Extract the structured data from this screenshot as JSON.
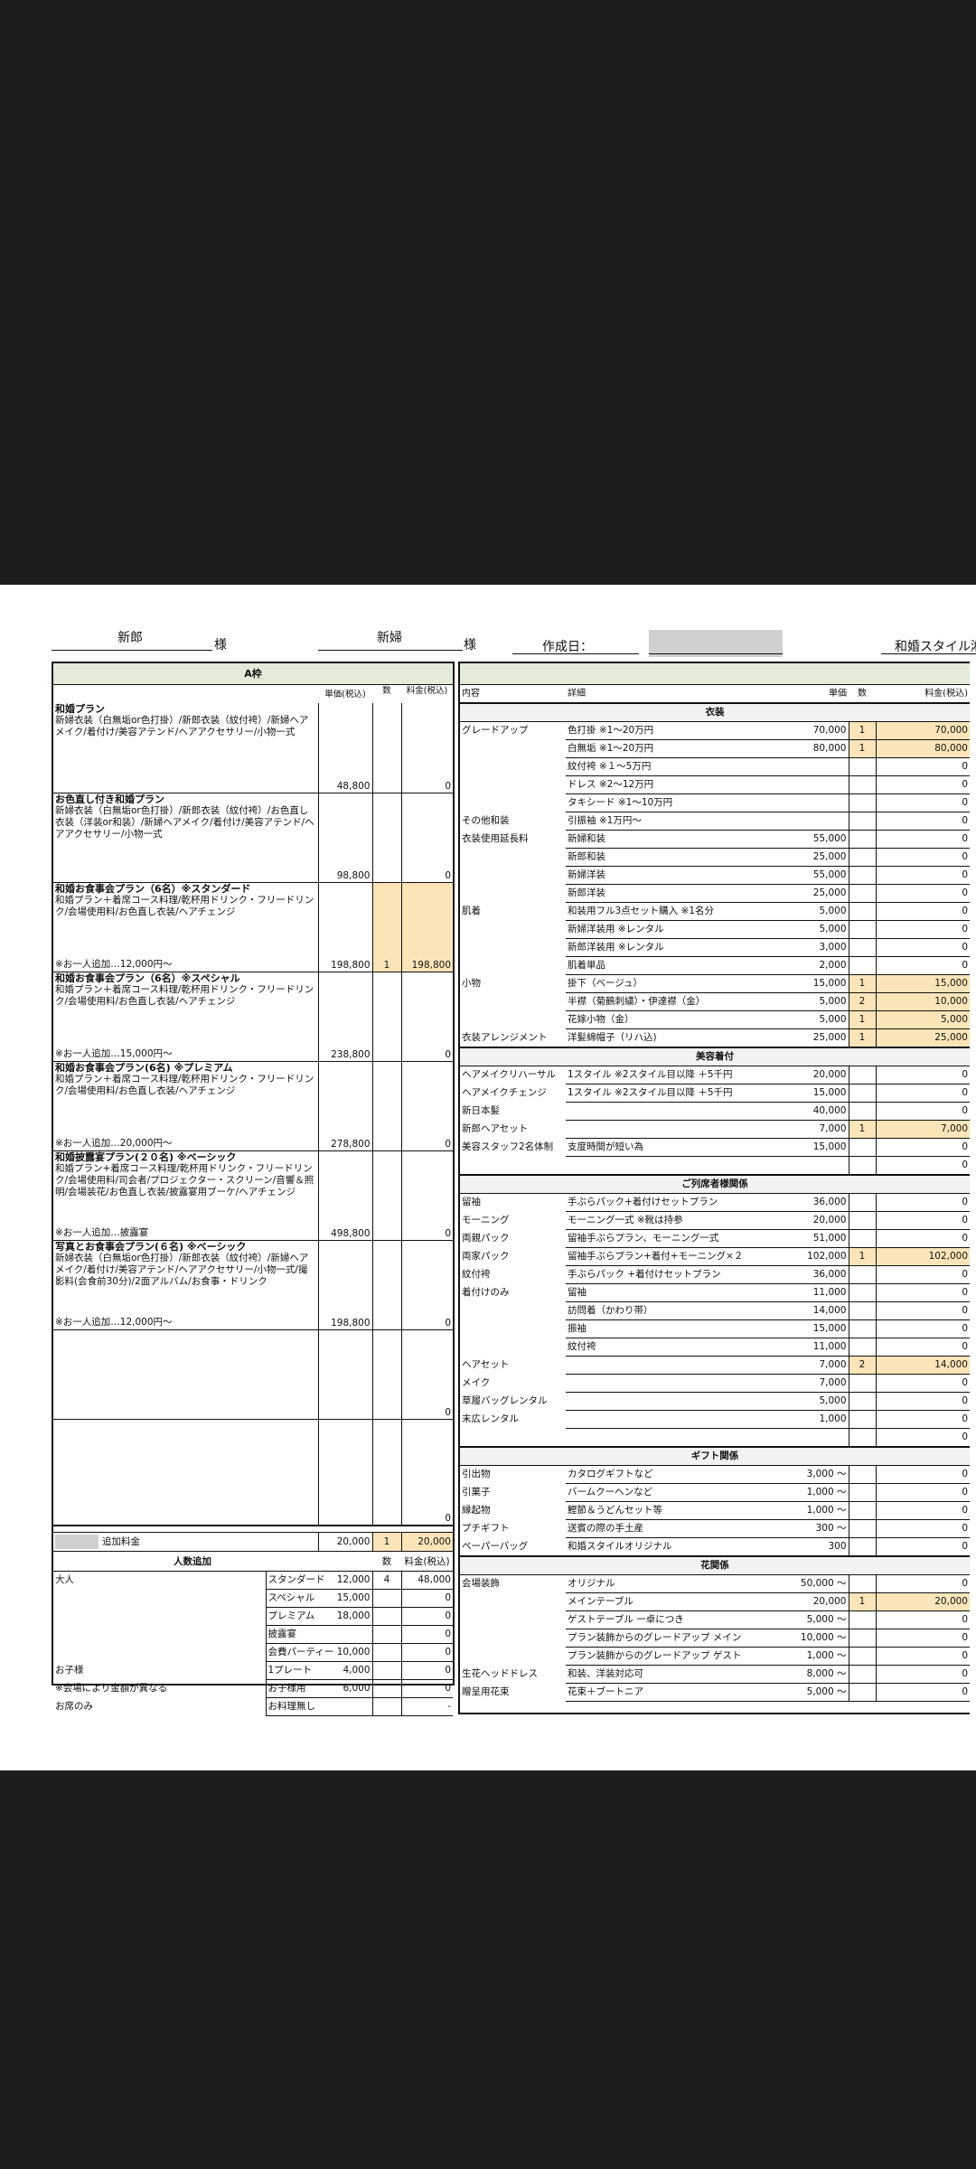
{
  "header": {
    "groom_label": "新郎",
    "bride_label": "新婦",
    "sama": "様",
    "created_label": "作成日：",
    "brand": "和婚スタイル湘"
  },
  "left": {
    "band": "A枠",
    "col_unit": "単価(税込)",
    "col_qty": "数",
    "col_fee": "料金(税込)",
    "plans": [
      {
        "title": "和婚プラン",
        "desc": "新婦衣装（白無垢or色打掛）/新郎衣装（紋付袴）/新婦ヘアメイク/着付け/美容アテンド/ヘアアクセサリー/小物一式",
        "note": "",
        "unit": "48,800",
        "qty": "",
        "fee": "0",
        "h": 99,
        "hl": false
      },
      {
        "title": "お色直し付き和婚プラン",
        "desc": "新婦衣装（白無垢or色打掛）/新郎衣装（紋付袴）/お色直し衣装（洋装or和装）/新婦ヘアメイク/着付け/美容アテンド/ヘアアクセサリー/小物一式",
        "note": "",
        "unit": "98,800",
        "qty": "",
        "fee": "0",
        "h": 99,
        "hl": false
      },
      {
        "title": "和婚お食事会プラン（6名）※スタンダード",
        "desc": "和婚プラン＋着席コース料理/乾杯用ドリンク・フリードリンク/会場使用料/お色直し衣装/ヘアチェンジ",
        "note": "※お一人追加…12,000円～",
        "unit": "198,800",
        "qty": "1",
        "fee": "198,800",
        "h": 99,
        "hl": true
      },
      {
        "title": "和婚お食事会プラン（6名）※スペシャル",
        "desc": "和婚プラン＋着席コース料理/乾杯用ドリンク・フリードリンク/会場使用料/お色直し衣装/ヘアチェンジ",
        "note": "※お一人追加…15,000円～",
        "unit": "238,800",
        "qty": "",
        "fee": "0",
        "h": 99,
        "hl": false
      },
      {
        "title": "和婚お食事会プラン(6名) ※プレミアム",
        "desc": "和婚プラン＋着席コース料理/乾杯用ドリンク・フリードリンク/会場使用料/お色直し衣装/ヘアチェンジ",
        "note": "※お一人追加…20,000円～",
        "unit": "278,800",
        "qty": "",
        "fee": "0",
        "h": 99,
        "hl": false
      },
      {
        "title": "和婚披露宴プラン(２０名) ※ベーシック",
        "desc": "和婚プラン+着席コース料理/乾杯用ドリンク・フリードリンク/会場使用料/司会者/プロジェクター・スクリーン/音響＆照明/会場装花/お色直し衣装/披露宴用ブーケ/ヘアチェンジ",
        "note": "※お一人追加…披露宴",
        "unit": "498,800",
        "qty": "",
        "fee": "0",
        "h": 99,
        "hl": false
      },
      {
        "title": "写真とお食事会プラン(６名) ※ベーシック",
        "desc": "新婦衣装（白無垢or色打掛）/新郎衣装（紋付袴）/新婦ヘアメイク/着付け/美容アテンド/ヘアアクセサリー/小物一式/撮影料(会食前30分)/2面アルバム/お食事・ドリンク",
        "note": "※お一人追加…12,000円～",
        "unit": "198,800",
        "qty": "",
        "fee": "0",
        "h": 99,
        "hl": false
      },
      {
        "title": "",
        "desc": "",
        "note": "",
        "unit": "",
        "qty": "",
        "fee": "0",
        "h": 99,
        "hl": false
      },
      {
        "title": "",
        "desc": "",
        "note": "",
        "unit": "",
        "qty": "",
        "fee": "0",
        "h": 117,
        "hl": false
      }
    ],
    "extra": {
      "label": "追加料金",
      "unit": "20,000",
      "qty": "1",
      "fee": "20,000"
    },
    "persons": {
      "title": "人数追加",
      "col_qty": "数",
      "col_fee": "料金(税込)",
      "rows": [
        {
          "a": "大人",
          "b": "スタンダード",
          "u": "12,000",
          "q": "4",
          "f": "48,000"
        },
        {
          "a": "",
          "b": "スペシャル",
          "u": "15,000",
          "q": "",
          "f": "0"
        },
        {
          "a": "",
          "b": "プレミアム",
          "u": "18,000",
          "q": "",
          "f": "0"
        },
        {
          "a": "",
          "b": "披露宴",
          "u": "",
          "q": "",
          "f": "0"
        },
        {
          "a": "",
          "b": "会費パーティー",
          "u": "10,000",
          "q": "",
          "f": "0"
        },
        {
          "a": "お子様",
          "b": "1プレート",
          "u": "4,000",
          "q": "",
          "f": "0"
        },
        {
          "a": "※会場により金額が異なる",
          "b": "お子様用",
          "u": "6,000",
          "q": "",
          "f": "0"
        },
        {
          "a": "お席のみ",
          "b": "お料理無し",
          "u": "",
          "q": "",
          "f": "-"
        }
      ]
    }
  },
  "right": {
    "col_headers": {
      "content": "内容",
      "detail": "詳細",
      "unit": "単価",
      "qty": "数",
      "fee": "料金(税込)"
    },
    "sections": [
      {
        "title": "衣装",
        "rows": [
          {
            "a": "グレードアップ",
            "b": "色打掛 ※1～20万円",
            "u": "70,000",
            "q": "1",
            "f": "70,000"
          },
          {
            "a": "",
            "b": "白無垢 ※1～20万円",
            "u": "80,000",
            "q": "1",
            "f": "80,000"
          },
          {
            "a": "",
            "b": "紋付袴 ※１～5万円",
            "u": "",
            "q": "",
            "f": "0"
          },
          {
            "a": "",
            "b": "ドレス ※2～12万円",
            "u": "",
            "q": "",
            "f": "0"
          },
          {
            "a": "",
            "b": "タキシード ※1～10万円",
            "u": "",
            "q": "",
            "f": "0"
          },
          {
            "a": "その他和装",
            "b": "引振袖 ※1万円～",
            "u": "",
            "q": "",
            "f": "0"
          },
          {
            "a": "衣装使用延長料",
            "b": "新婦和装",
            "u": "55,000",
            "q": "",
            "f": "0"
          },
          {
            "a": "",
            "b": "新郎和装",
            "u": "25,000",
            "q": "",
            "f": "0"
          },
          {
            "a": "",
            "b": "新婦洋装",
            "u": "55,000",
            "q": "",
            "f": "0"
          },
          {
            "a": "",
            "b": "新郎洋装",
            "u": "25,000",
            "q": "",
            "f": "0"
          },
          {
            "a": "肌着",
            "b": "和装用フル3点セット購入 ※1名分",
            "u": "5,000",
            "q": "",
            "f": "0"
          },
          {
            "a": "",
            "b": "新婦洋装用 ※レンタル",
            "u": "5,000",
            "q": "",
            "f": "0"
          },
          {
            "a": "",
            "b": "新郎洋装用 ※レンタル",
            "u": "3,000",
            "q": "",
            "f": "0"
          },
          {
            "a": "",
            "b": "肌着単品",
            "u": "2,000",
            "q": "",
            "f": "0"
          },
          {
            "a": "小物",
            "b": "掛下（ベージュ）",
            "u": "15,000",
            "q": "1",
            "f": "15,000"
          },
          {
            "a": "",
            "b": "半襟（菊鶴刺繍）・伊達襟（金）",
            "u": "5,000",
            "q": "2",
            "f": "10,000"
          },
          {
            "a": "",
            "b": "花嫁小物（金）",
            "u": "5,000",
            "q": "1",
            "f": "5,000"
          },
          {
            "a": "衣装アレンジメント",
            "b": "洋髪綿帽子（リハ込)",
            "u": "25,000",
            "q": "1",
            "f": "25,000"
          }
        ]
      },
      {
        "title": "美容着付",
        "rows": [
          {
            "a": "ヘアメイクリハーサル",
            "b": "1スタイル ※2スタイル目以降 ＋5千円",
            "u": "20,000",
            "q": "",
            "f": "0"
          },
          {
            "a": "ヘアメイクチェンジ",
            "b": "1スタイル ※2スタイル目以降 ＋5千円",
            "u": "15,000",
            "q": "",
            "f": "0"
          },
          {
            "a": "新日本髪",
            "b": "",
            "u": "40,000",
            "q": "",
            "f": "0"
          },
          {
            "a": "新郎ヘアセット",
            "b": "",
            "u": "7,000",
            "q": "1",
            "f": "7,000"
          },
          {
            "a": "美容スタッフ2名体制",
            "b": "支度時間が短い為",
            "u": "15,000",
            "q": "",
            "f": "0"
          },
          {
            "a": "",
            "b": "",
            "u": "",
            "q": "",
            "f": "0"
          }
        ]
      },
      {
        "title": "ご列席者様関係",
        "rows": [
          {
            "a": "留袖",
            "b": "手ぶらパック+着付けセットプラン",
            "u": "36,000",
            "q": "",
            "f": "0"
          },
          {
            "a": "モーニング",
            "b": "モーニング一式 ※靴は持参",
            "u": "20,000",
            "q": "",
            "f": "0"
          },
          {
            "a": "両親パック",
            "b": "留袖手ぶらプラン、モーニング一式",
            "u": "51,000",
            "q": "",
            "f": "0"
          },
          {
            "a": "両家パック",
            "b": "留袖手ぶらプラン+着付+モーニング×２",
            "u": "102,000",
            "q": "1",
            "f": "102,000"
          },
          {
            "a": "紋付袴",
            "b": "手ぶらパック +着付けセットプラン",
            "u": "36,000",
            "q": "",
            "f": "0"
          },
          {
            "a": "着付けのみ",
            "b": "留袖",
            "u": "11,000",
            "q": "",
            "f": "0"
          },
          {
            "a": "",
            "b": "訪問着（かわり帯）",
            "u": "14,000",
            "q": "",
            "f": "0"
          },
          {
            "a": "",
            "b": "振袖",
            "u": "15,000",
            "q": "",
            "f": "0"
          },
          {
            "a": "",
            "b": "紋付袴",
            "u": "11,000",
            "q": "",
            "f": "0"
          },
          {
            "a": "ヘアセット",
            "b": "",
            "u": "7,000",
            "q": "2",
            "f": "14,000"
          },
          {
            "a": "メイク",
            "b": "",
            "u": "7,000",
            "q": "",
            "f": "0"
          },
          {
            "a": "草履バッグレンタル",
            "b": "",
            "u": "5,000",
            "q": "",
            "f": "0"
          },
          {
            "a": "末広レンタル",
            "b": "",
            "u": "1,000",
            "q": "",
            "f": "0"
          },
          {
            "a": "",
            "b": "",
            "u": "",
            "q": "",
            "f": "0"
          }
        ]
      },
      {
        "title": "ギフト関係",
        "rows": [
          {
            "a": "引出物",
            "b": "カタログギフトなど",
            "u": "3,000 ～",
            "q": "",
            "f": "0"
          },
          {
            "a": "引菓子",
            "b": "バームクーヘンなど",
            "u": "1,000 ～",
            "q": "",
            "f": "0"
          },
          {
            "a": "縁起物",
            "b": "鰹節＆うどんセット等",
            "u": "1,000 ～",
            "q": "",
            "f": "0"
          },
          {
            "a": "プチギフト",
            "b": "送賓の際の手土産",
            "u": "300 ～",
            "q": "",
            "f": "0"
          },
          {
            "a": "ペーパーバッグ",
            "b": "和婚スタイルオリジナル",
            "u": "300",
            "q": "",
            "f": "0"
          }
        ]
      },
      {
        "title": "花関係",
        "rows": [
          {
            "a": "会場装飾",
            "b": "オリジナル",
            "u": "50,000 ～",
            "q": "",
            "f": "0"
          },
          {
            "a": "",
            "b": "メインテーブル",
            "u": "20,000",
            "q": "1",
            "f": "20,000"
          },
          {
            "a": "",
            "b": "ゲストテーブル 一卓につき",
            "u": "5,000 ～",
            "q": "",
            "f": "0"
          },
          {
            "a": "",
            "b": "プラン装飾からのグレードアップ メイン",
            "u": "10,000 ～",
            "q": "",
            "f": "0"
          },
          {
            "a": "",
            "b": "プラン装飾からのグレードアップ ゲスト",
            "u": "1,000 ～",
            "q": "",
            "f": "0"
          },
          {
            "a": "生花ヘッドドレス",
            "b": "和装、洋装対応可",
            "u": "8,000 ～",
            "q": "",
            "f": "0"
          },
          {
            "a": "贈呈用花束",
            "b": "花束＋ブートニア",
            "u": "5,000 ～",
            "q": "",
            "f": "0"
          }
        ]
      }
    ]
  }
}
